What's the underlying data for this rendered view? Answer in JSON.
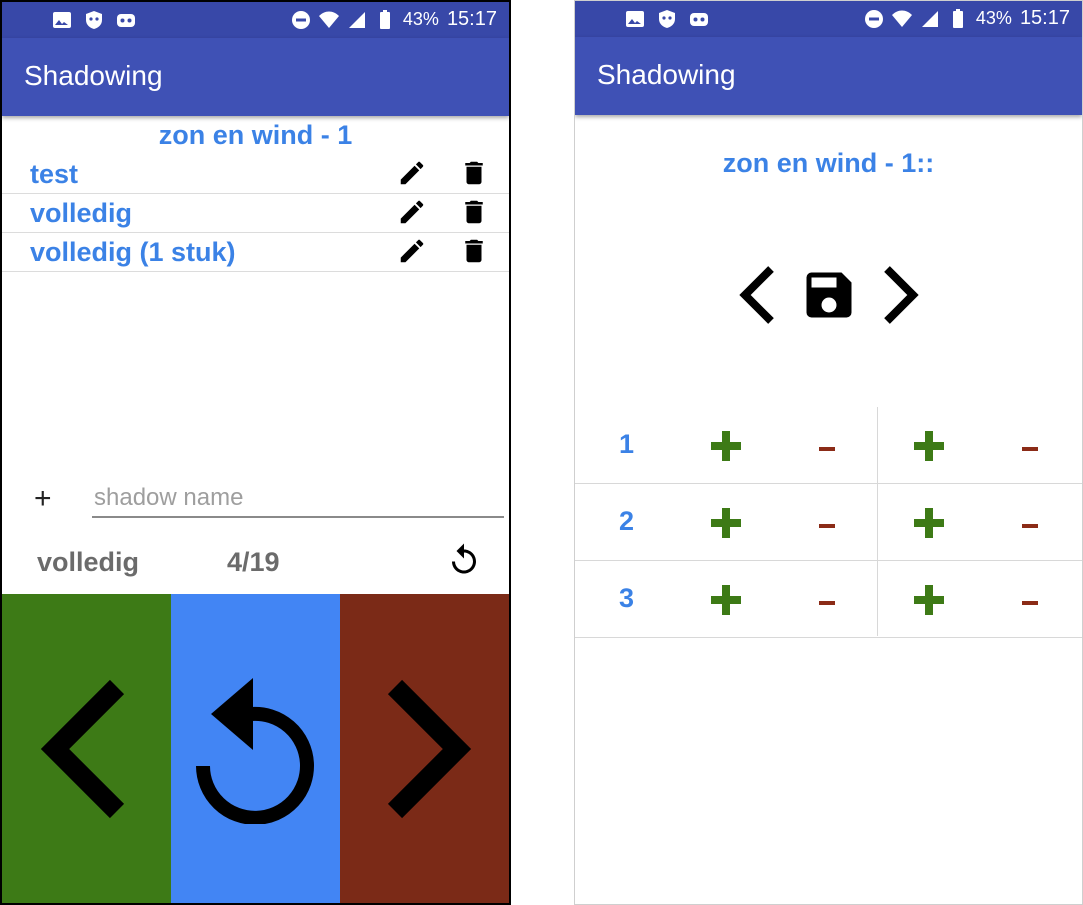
{
  "left_phone": {
    "status_bar": {
      "battery": "43%",
      "time": "15:17"
    },
    "app_title": "Shadowing",
    "section_title": "zon en wind - 1",
    "shadows": [
      {
        "label": "test"
      },
      {
        "label": "volledig"
      },
      {
        "label": "volledig (1 stuk)"
      }
    ],
    "add": {
      "plus": "+",
      "placeholder": "shadow name"
    },
    "current": {
      "name": "volledig",
      "progress": "4/19"
    },
    "colors": {
      "prev": "#3d7a16",
      "replay": "#4285f4",
      "next": "#7b2a17",
      "accent": "#3b82e6"
    }
  },
  "right_phone": {
    "status_bar": {
      "battery": "43%",
      "time": "15:17"
    },
    "app_title": "Shadowing",
    "section_title": "zon en wind - 1::",
    "rows": [
      {
        "num": "1"
      },
      {
        "num": "2"
      },
      {
        "num": "3"
      }
    ],
    "colors": {
      "plus": "#3d7a16",
      "minus": "#8b2b17"
    }
  }
}
